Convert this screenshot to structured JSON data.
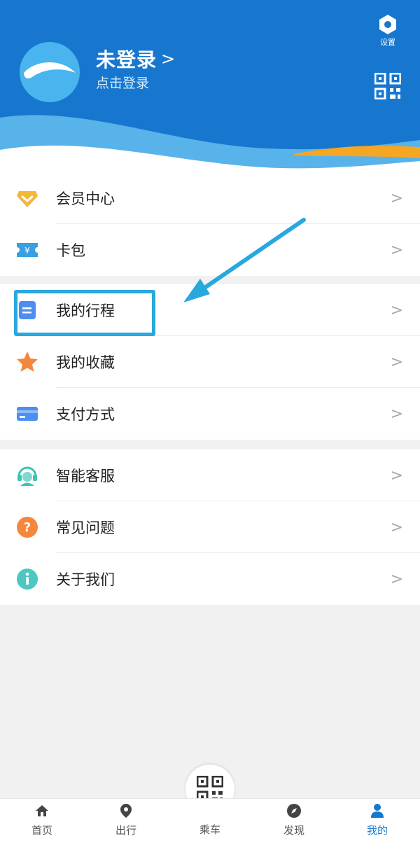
{
  "header": {
    "title": "未登录",
    "title_chevron": ">",
    "subtitle": "点击登录",
    "settings_label": "设置",
    "colors": {
      "background": "#1777cf",
      "wave_light": "#5fb9ec",
      "wave_orange": "#f5a623"
    }
  },
  "sections": [
    {
      "items": [
        {
          "label": "会员中心",
          "icon": "diamond-icon",
          "color": "#f4b63b"
        },
        {
          "label": "卡包",
          "icon": "ticket-icon",
          "color": "#3a9fe0"
        }
      ]
    },
    {
      "items": [
        {
          "label": "我的行程",
          "icon": "itinerary-icon",
          "color": "#4f8df0"
        },
        {
          "label": "我的收藏",
          "icon": "star-icon",
          "color": "#f5873d"
        },
        {
          "label": "支付方式",
          "icon": "card-icon",
          "color": "#4b8ff0"
        }
      ]
    },
    {
      "items": [
        {
          "label": "智能客服",
          "icon": "headset-icon",
          "color": "#3ec4b4"
        },
        {
          "label": "常见问题",
          "icon": "question-icon",
          "color": "#f5873d"
        },
        {
          "label": "关于我们",
          "icon": "info-icon",
          "color": "#4cc7c1"
        }
      ]
    }
  ],
  "row_chevron": ">",
  "tabbar": {
    "tabs": [
      {
        "label": "首页",
        "icon": "home-icon"
      },
      {
        "label": "出行",
        "icon": "location-pin-icon"
      },
      {
        "label": "乘车",
        "icon": "qr-code-icon"
      },
      {
        "label": "发现",
        "icon": "compass-icon"
      },
      {
        "label": "我的",
        "icon": "user-icon",
        "active": true
      }
    ],
    "active_color": "#1777cf"
  },
  "annotation": {
    "color": "#29a8de"
  }
}
